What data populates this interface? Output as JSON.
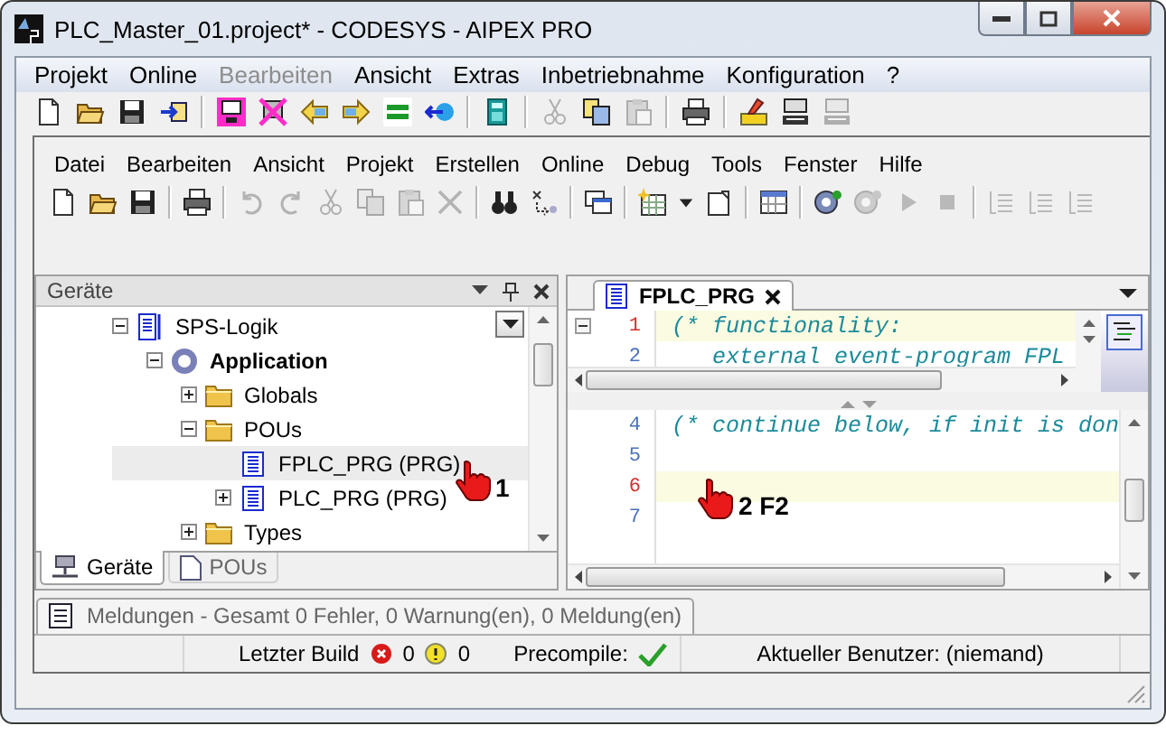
{
  "window": {
    "title": "PLC_Master_01.project* - CODESYS  - AIPEX PRO"
  },
  "menu": [
    {
      "label": "Projekt",
      "disabled": false
    },
    {
      "label": "Online",
      "disabled": false
    },
    {
      "label": "Bearbeiten",
      "disabled": true
    },
    {
      "label": "Ansicht",
      "disabled": false
    },
    {
      "label": "Extras",
      "disabled": false
    },
    {
      "label": "Inbetriebnahme",
      "disabled": false
    },
    {
      "label": "Konfiguration",
      "disabled": false
    },
    {
      "label": "?",
      "disabled": false
    }
  ],
  "toolbar": [
    {
      "kind": "new",
      "disabled": false
    },
    {
      "kind": "open",
      "disabled": false
    },
    {
      "kind": "save",
      "disabled": false
    },
    {
      "kind": "import",
      "disabled": false
    },
    {
      "kind": "sep"
    },
    {
      "kind": "monitor",
      "disabled": false
    },
    {
      "kind": "crossed",
      "disabled": false
    },
    {
      "kind": "left",
      "disabled": false
    },
    {
      "kind": "right",
      "disabled": false
    },
    {
      "kind": "equal",
      "disabled": false
    },
    {
      "kind": "back",
      "disabled": false
    },
    {
      "kind": "sep"
    },
    {
      "kind": "calculator",
      "disabled": false
    },
    {
      "kind": "sep"
    },
    {
      "kind": "cut",
      "disabled": true
    },
    {
      "kind": "copy",
      "disabled": false
    },
    {
      "kind": "paste",
      "disabled": true
    },
    {
      "kind": "sep"
    },
    {
      "kind": "print",
      "disabled": false
    },
    {
      "kind": "sep"
    },
    {
      "kind": "pen",
      "disabled": false
    },
    {
      "kind": "computer",
      "disabled": false
    },
    {
      "kind": "computer",
      "disabled": true
    }
  ],
  "inner_window": {
    "menu": [
      {
        "label": "Datei"
      },
      {
        "label": "Bearbeiten"
      },
      {
        "label": "Ansicht"
      },
      {
        "label": "Projekt"
      },
      {
        "label": "Erstellen"
      },
      {
        "label": "Online"
      },
      {
        "label": "Debug"
      },
      {
        "label": "Tools"
      },
      {
        "label": "Fenster"
      },
      {
        "label": "Hilfe"
      }
    ],
    "toolbar": [
      {
        "kind": "new",
        "disabled": false
      },
      {
        "kind": "open",
        "disabled": false
      },
      {
        "kind": "save",
        "disabled": false
      },
      {
        "kind": "sep"
      },
      {
        "kind": "print",
        "disabled": false
      },
      {
        "kind": "sep"
      },
      {
        "kind": "undo",
        "disabled": true
      },
      {
        "kind": "redo",
        "disabled": true
      },
      {
        "kind": "cut",
        "disabled": true
      },
      {
        "kind": "copy",
        "disabled": true
      },
      {
        "kind": "paste",
        "disabled": true
      },
      {
        "kind": "delete",
        "disabled": true
      },
      {
        "kind": "sep"
      },
      {
        "kind": "binoculars",
        "disabled": false
      },
      {
        "kind": "replace",
        "disabled": false
      },
      {
        "kind": "sep"
      },
      {
        "kind": "windows",
        "disabled": false
      },
      {
        "kind": "sep"
      },
      {
        "kind": "grid",
        "disabled": false
      },
      {
        "kind": "caret",
        "disabled": false
      },
      {
        "kind": "page",
        "disabled": false
      },
      {
        "kind": "sep"
      },
      {
        "kind": "table",
        "disabled": false
      },
      {
        "kind": "sep"
      },
      {
        "kind": "gear",
        "disabled": false
      },
      {
        "kind": "gear",
        "disabled": true
      },
      {
        "kind": "play",
        "disabled": true
      },
      {
        "kind": "stop",
        "disabled": true
      },
      {
        "kind": "sep"
      },
      {
        "kind": "indent",
        "disabled": true
      },
      {
        "kind": "indent",
        "disabled": true
      },
      {
        "kind": "indent",
        "disabled": true
      }
    ],
    "devices_panel": {
      "title": "Geräte",
      "tree": [
        {
          "label": "SPS-Logik",
          "kind": "device",
          "leaf": false,
          "expanded": true,
          "selected": false,
          "children": [
            {
              "label": "Application",
              "kind": "application",
              "leaf": false,
              "expanded": true,
              "selected": false,
              "children": [
                {
                  "label": "Globals",
                  "kind": "folder",
                  "leaf": false,
                  "expanded": false,
                  "selected": false
                },
                {
                  "label": "POUs",
                  "kind": "folder",
                  "leaf": false,
                  "expanded": true,
                  "selected": false,
                  "children": [
                    {
                      "label": "FPLC_PRG (PRG)",
                      "kind": "pou",
                      "leaf": true,
                      "expanded": false,
                      "selected": true
                    },
                    {
                      "label": "PLC_PRG (PRG)",
                      "kind": "pou",
                      "leaf": false,
                      "expanded": false,
                      "selected": false
                    }
                  ]
                },
                {
                  "label": "Types",
                  "kind": "folder",
                  "leaf": false,
                  "expanded": false,
                  "selected": false
                }
              ]
            }
          ]
        }
      ],
      "tabs": [
        {
          "label": "Geräte",
          "selected": true
        },
        {
          "label": "POUs",
          "selected": false
        }
      ]
    },
    "editor": {
      "tabs": [
        {
          "label": "FPLC_PRG",
          "selected": true
        }
      ],
      "top_pane": [
        {
          "number": "1",
          "text": "(* functionality:",
          "current": true,
          "fold": true
        },
        {
          "number": "2",
          "text": "   external event-program FPL",
          "current": false,
          "fold": false
        }
      ],
      "bottom_pane": [
        {
          "number": "4",
          "text": "(* continue below, if init is don",
          "current": false,
          "fold": false
        },
        {
          "number": "5",
          "current": false,
          "fold": false
        },
        {
          "number": "6",
          "current": true,
          "fold": false
        },
        {
          "number": "7",
          "current": false,
          "fold": false
        }
      ]
    },
    "messages_tab": {
      "label": "Meldungen - Gesamt 0 Fehler, 0 Warnung(en), 0 Meldung(en)"
    },
    "status_bar": {
      "build_label": "Letzter Build",
      "errors": "0",
      "warnings": "0",
      "precompile_label": "Precompile:",
      "precompile_ok": true,
      "user": "Aktueller Benutzer: (niemand)"
    }
  },
  "annotations": [
    {
      "label": "1"
    },
    {
      "label": "2 F2"
    }
  ]
}
